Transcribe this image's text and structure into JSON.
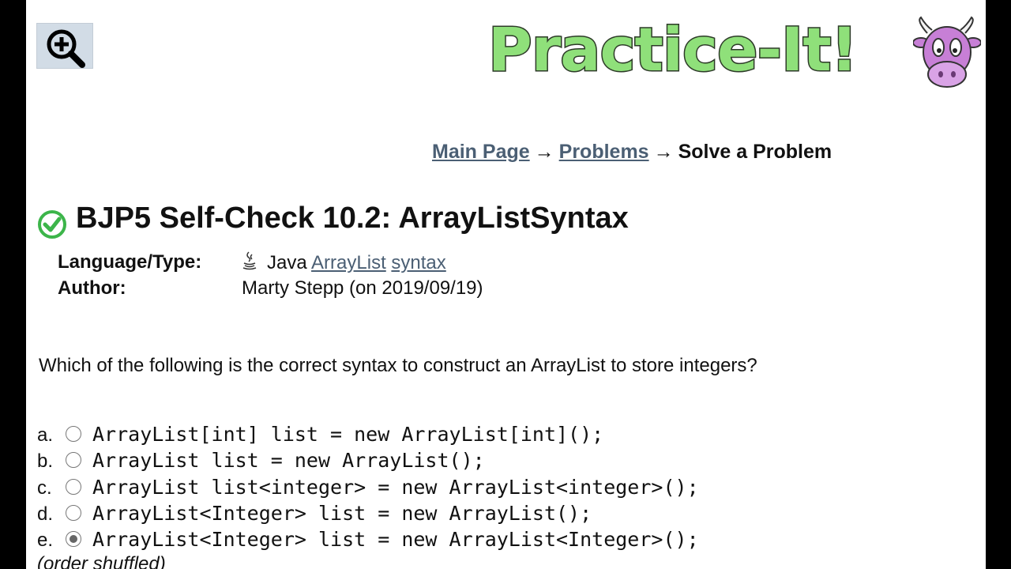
{
  "logo": {
    "text": "Practice-It!"
  },
  "breadcrumb": {
    "main_page": "Main Page",
    "problems": "Problems",
    "current": "Solve a Problem",
    "separator": "→"
  },
  "problem": {
    "title": "BJP5 Self-Check 10.2: ArrayListSyntax",
    "status_color": "#3cb54a",
    "language_label": "Language/Type:",
    "language": "Java",
    "tags": [
      "ArrayList",
      "syntax"
    ],
    "author_label": "Author:",
    "author": "Marty Stepp (on 2019/09/19)",
    "question": "Which of the following is the correct syntax to construct an ArrayList to store integers?",
    "choices": [
      {
        "letter": "a.",
        "code": "ArrayList[int] list = new ArrayList[int]();",
        "selected": false
      },
      {
        "letter": "b.",
        "code": "ArrayList list = new ArrayList();",
        "selected": false
      },
      {
        "letter": "c.",
        "code": "ArrayList list<integer> = new ArrayList<integer>();",
        "selected": false
      },
      {
        "letter": "d.",
        "code": "ArrayList<Integer> list = new ArrayList();",
        "selected": false
      },
      {
        "letter": "e.",
        "code": "ArrayList<Integer> list = new ArrayList<Integer>();",
        "selected": true
      }
    ],
    "note": "(order shuffled)"
  }
}
